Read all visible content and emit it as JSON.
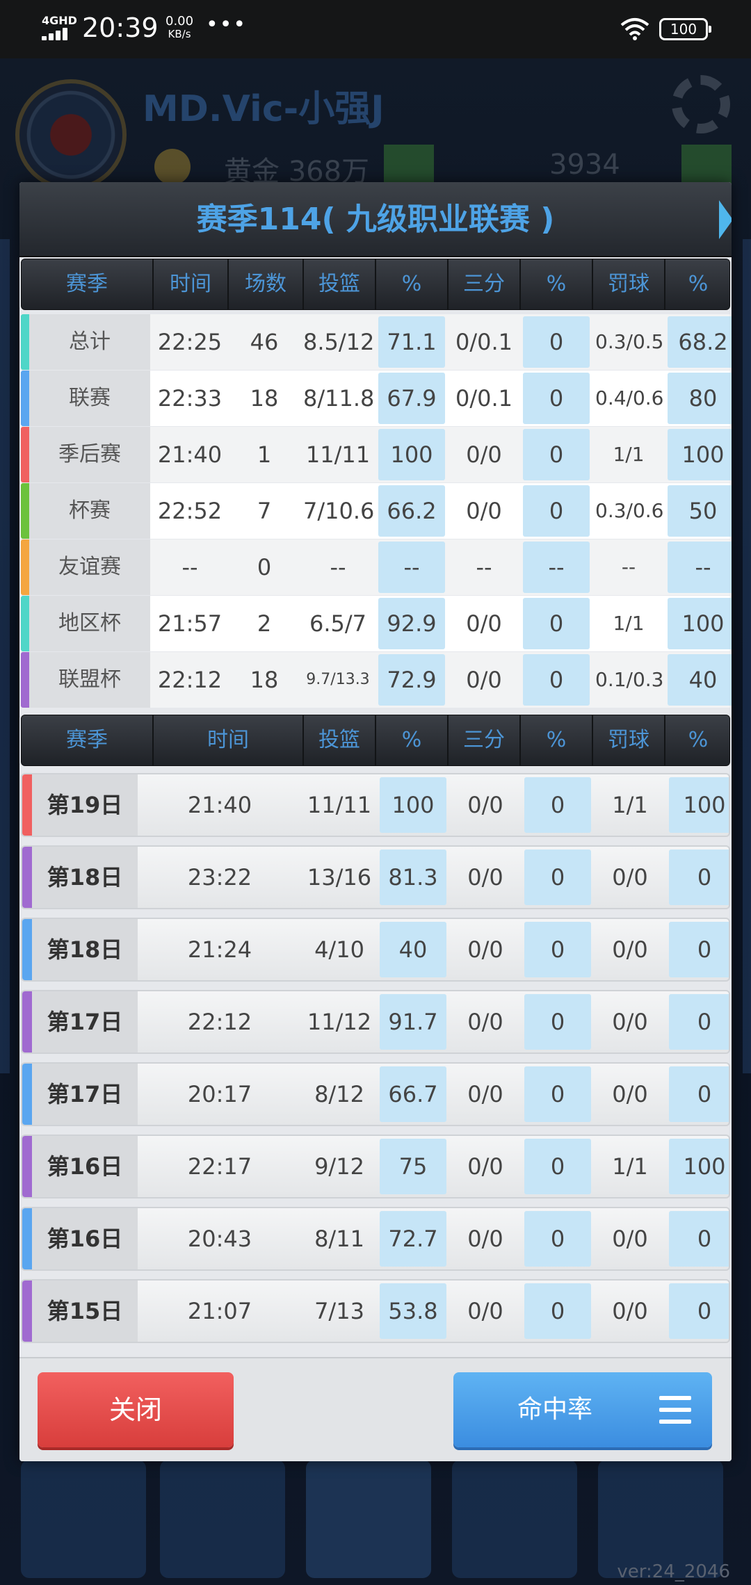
{
  "status_bar": {
    "network": "4GHD",
    "time": "20:39",
    "speed_value": "0.00",
    "speed_unit": "KB/s",
    "dots": "•••",
    "battery": "100"
  },
  "background": {
    "team_name": "MD.Vic-小强J",
    "stat1": "黄金 368万",
    "stat2": "3934",
    "version": "ver:24_2046"
  },
  "dialog": {
    "title": "赛季114( 九级职业联赛 )",
    "colors": {
      "accent_blue": "#4ea3e6",
      "cell_blue": "#c6e5f7",
      "close_red": "#e24a49",
      "rate_blue": "#4a9eea"
    },
    "summary_headers": [
      "赛季",
      "时间",
      "场数",
      "投篮",
      "%",
      "三分",
      "%",
      "罚球",
      "%"
    ],
    "summary_rows": [
      {
        "label": "总计",
        "time": "22:25",
        "games": "46",
        "fg": "8.5/12",
        "fg_pct": "71.1",
        "three": "0/0.1",
        "three_pct": "0",
        "ft": "0.3/0.5",
        "ft_pct": "68.2",
        "stripe": "#4fd6c8"
      },
      {
        "label": "联赛",
        "time": "22:33",
        "games": "18",
        "fg": "8/11.8",
        "fg_pct": "67.9",
        "three": "0/0.1",
        "three_pct": "0",
        "ft": "0.4/0.6",
        "ft_pct": "80",
        "stripe": "#5aa6f0"
      },
      {
        "label": "季后赛",
        "time": "21:40",
        "games": "1",
        "fg": "11/11",
        "fg_pct": "100",
        "three": "0/0",
        "three_pct": "0",
        "ft": "1/1",
        "ft_pct": "100",
        "stripe": "#f06060"
      },
      {
        "label": "杯赛",
        "time": "22:52",
        "games": "7",
        "fg": "7/10.6",
        "fg_pct": "66.2",
        "three": "0/0",
        "three_pct": "0",
        "ft": "0.3/0.6",
        "ft_pct": "50",
        "stripe": "#6cc23c"
      },
      {
        "label": "友谊赛",
        "time": "--",
        "games": "0",
        "fg": "--",
        "fg_pct": "--",
        "three": "--",
        "three_pct": "--",
        "ft": "--",
        "ft_pct": "--",
        "stripe": "#f4a640"
      },
      {
        "label": "地区杯",
        "time": "21:57",
        "games": "2",
        "fg": "6.5/7",
        "fg_pct": "92.9",
        "three": "0/0",
        "three_pct": "0",
        "ft": "1/1",
        "ft_pct": "100",
        "stripe": "#4fd6c8"
      },
      {
        "label": "联盟杯",
        "time": "22:12",
        "games": "18",
        "fg": "9.7/13.3",
        "fg_pct": "72.9",
        "three": "0/0",
        "three_pct": "0",
        "ft": "0.1/0.3",
        "ft_pct": "40",
        "stripe": "#a06ad0"
      }
    ],
    "game_headers": [
      "赛季",
      "时间",
      "投篮",
      "%",
      "三分",
      "%",
      "罚球",
      "%"
    ],
    "game_rows": [
      {
        "label": "第19日",
        "time": "21:40",
        "fg": "11/11",
        "fg_pct": "100",
        "three": "0/0",
        "three_pct": "0",
        "ft": "1/1",
        "ft_pct": "100",
        "stripe": "#f06060"
      },
      {
        "label": "第18日",
        "time": "23:22",
        "fg": "13/16",
        "fg_pct": "81.3",
        "three": "0/0",
        "three_pct": "0",
        "ft": "0/0",
        "ft_pct": "0",
        "stripe": "#a06ad0"
      },
      {
        "label": "第18日",
        "time": "21:24",
        "fg": "4/10",
        "fg_pct": "40",
        "three": "0/0",
        "three_pct": "0",
        "ft": "0/0",
        "ft_pct": "0",
        "stripe": "#5aa6f0"
      },
      {
        "label": "第17日",
        "time": "22:12",
        "fg": "11/12",
        "fg_pct": "91.7",
        "three": "0/0",
        "three_pct": "0",
        "ft": "0/0",
        "ft_pct": "0",
        "stripe": "#a06ad0"
      },
      {
        "label": "第17日",
        "time": "20:17",
        "fg": "8/12",
        "fg_pct": "66.7",
        "three": "0/0",
        "three_pct": "0",
        "ft": "0/0",
        "ft_pct": "0",
        "stripe": "#5aa6f0"
      },
      {
        "label": "第16日",
        "time": "22:17",
        "fg": "9/12",
        "fg_pct": "75",
        "three": "0/0",
        "three_pct": "0",
        "ft": "1/1",
        "ft_pct": "100",
        "stripe": "#a06ad0"
      },
      {
        "label": "第16日",
        "time": "20:43",
        "fg": "8/11",
        "fg_pct": "72.7",
        "three": "0/0",
        "three_pct": "0",
        "ft": "0/0",
        "ft_pct": "0",
        "stripe": "#5aa6f0"
      },
      {
        "label": "第15日",
        "time": "21:07",
        "fg": "7/13",
        "fg_pct": "53.8",
        "three": "0/0",
        "three_pct": "0",
        "ft": "0/0",
        "ft_pct": "0",
        "stripe": "#a06ad0"
      }
    ],
    "close_label": "关闭",
    "rate_label": "命中率"
  }
}
